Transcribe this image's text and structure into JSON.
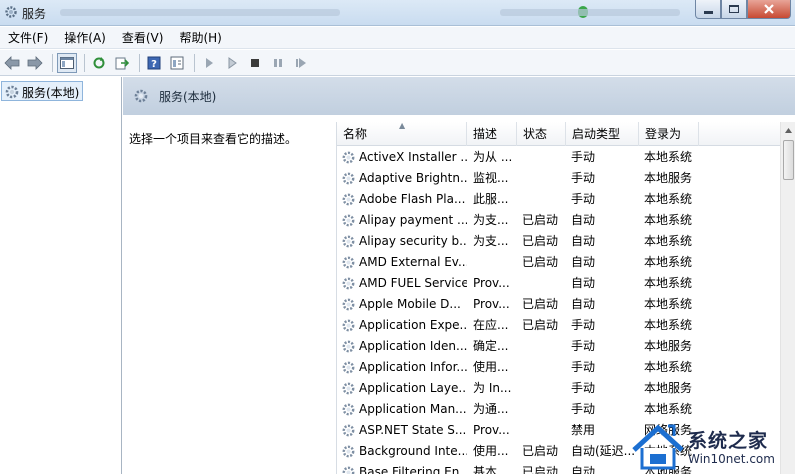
{
  "window": {
    "title": "服务"
  },
  "menu": [
    "文件(F)",
    "操作(A)",
    "查看(V)",
    "帮助(H)"
  ],
  "tree": {
    "root": "服务(本地)"
  },
  "panel": {
    "title": "服务(本地)",
    "description": "选择一个项目来查看它的描述。"
  },
  "table": {
    "columns": [
      "名称",
      "描述",
      "状态",
      "启动类型",
      "登录为"
    ],
    "rows": [
      [
        "ActiveX Installer ...",
        "为从 ...",
        "",
        "手动",
        "本地系统"
      ],
      [
        "Adaptive Brightn...",
        "监视...",
        "",
        "手动",
        "本地服务"
      ],
      [
        "Adobe Flash Pla...",
        "此服...",
        "",
        "手动",
        "本地系统"
      ],
      [
        "Alipay payment ...",
        "为支...",
        "已启动",
        "自动",
        "本地系统"
      ],
      [
        "Alipay security b...",
        "为支...",
        "已启动",
        "自动",
        "本地系统"
      ],
      [
        "AMD External Ev...",
        "",
        "已启动",
        "自动",
        "本地系统"
      ],
      [
        "AMD FUEL Service",
        "Prov...",
        "",
        "自动",
        "本地系统"
      ],
      [
        "Apple Mobile D...",
        "Prov...",
        "已启动",
        "自动",
        "本地系统"
      ],
      [
        "Application Expe...",
        "在应...",
        "已启动",
        "手动",
        "本地系统"
      ],
      [
        "Application Iden...",
        "确定...",
        "",
        "手动",
        "本地服务"
      ],
      [
        "Application Infor...",
        "使用...",
        "",
        "手动",
        "本地系统"
      ],
      [
        "Application Laye...",
        "为 In...",
        "",
        "手动",
        "本地服务"
      ],
      [
        "Application Man...",
        "为通...",
        "",
        "手动",
        "本地系统"
      ],
      [
        "ASP.NET State S...",
        "Prov...",
        "",
        "禁用",
        "网络服务"
      ],
      [
        "Background Inte...",
        "使用...",
        "已启动",
        "自动(延迟...",
        "本地系统"
      ],
      [
        "Base Filtering En...",
        "基本...",
        "已启动",
        "自动",
        "本地服务"
      ]
    ]
  },
  "watermark": {
    "line1": "系统之家",
    "line2": "Win10net.com"
  },
  "colors": {
    "accent": "#3a6ea5",
    "header_band": "#c9d6e5"
  }
}
